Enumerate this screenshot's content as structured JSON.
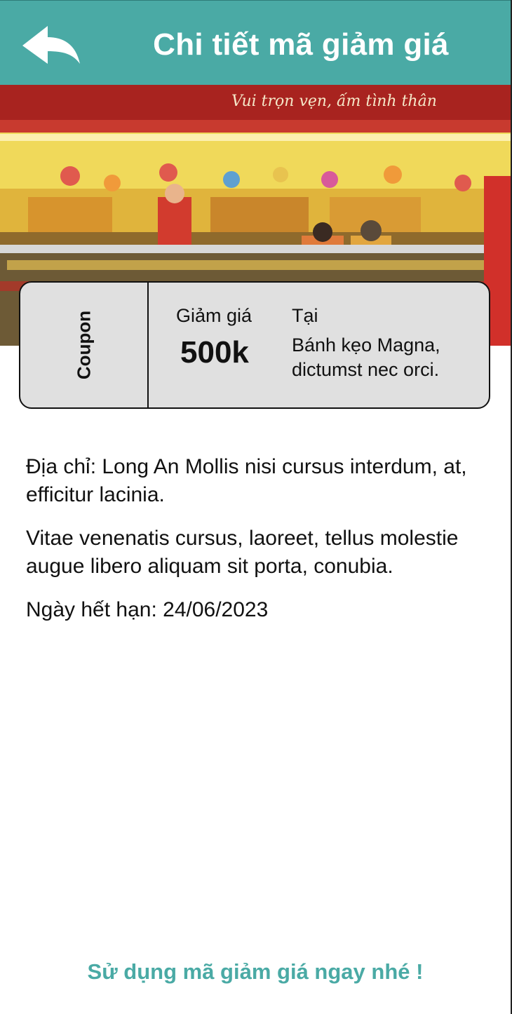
{
  "header": {
    "title": "Chi tiết mã giảm giá",
    "back_icon": "back-arrow-icon",
    "background_color": "#4aaaa5"
  },
  "coupon": {
    "tag": "Coupon",
    "discount_label": "Giảm giá",
    "discount_value": "500k",
    "at_label": "Tại",
    "place": "Bánh kẹo Magna, dictumst nec orci."
  },
  "details": {
    "address": "Địa chỉ: Long An Mollis nisi cursus interdum, at, efficitur lacinia.",
    "description": "Vitae venenatis cursus, laoreet, tellus molestie augue libero aliquam sit porta, conubia.",
    "expiry": "Ngày hết hạn: 24/06/2023"
  },
  "cta": {
    "label": "Sử dụng mã giảm giá ngay nhé !",
    "color": "#4aaaa5"
  }
}
